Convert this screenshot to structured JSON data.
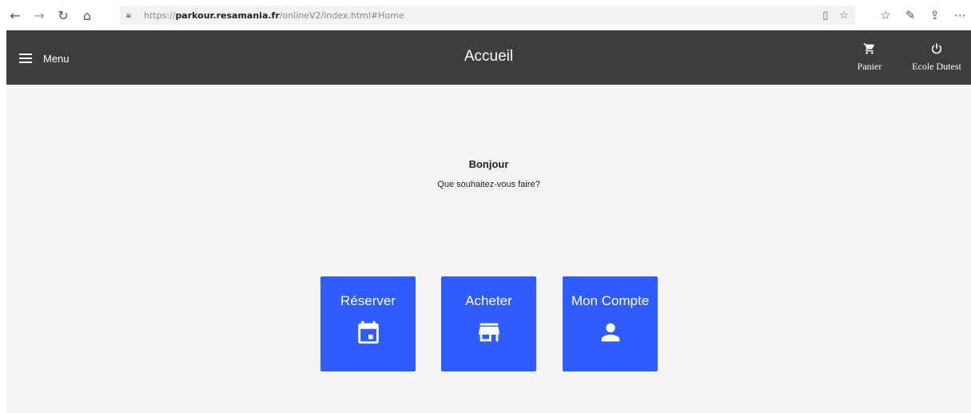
{
  "browser": {
    "url_protocol": "https://",
    "url_domain": "parkour.resamania.fr",
    "url_path": "/onlineV2/index.html#Home"
  },
  "header": {
    "menu_label": "Menu",
    "title": "Accueil",
    "cart_label": "Panier",
    "account_label": "Ecole Dutest"
  },
  "main": {
    "greeting": "Bonjour",
    "question": "Que souhaitez-vous faire?",
    "tiles": [
      {
        "label": "Réserver",
        "icon": "calendar-icon"
      },
      {
        "label": "Acheter",
        "icon": "store-icon"
      },
      {
        "label": "Mon Compte",
        "icon": "person-icon"
      }
    ]
  },
  "colors": {
    "header_bg": "#3d3d3d",
    "tile_bg": "#2e5cff",
    "page_bg": "#f5f5f5"
  }
}
